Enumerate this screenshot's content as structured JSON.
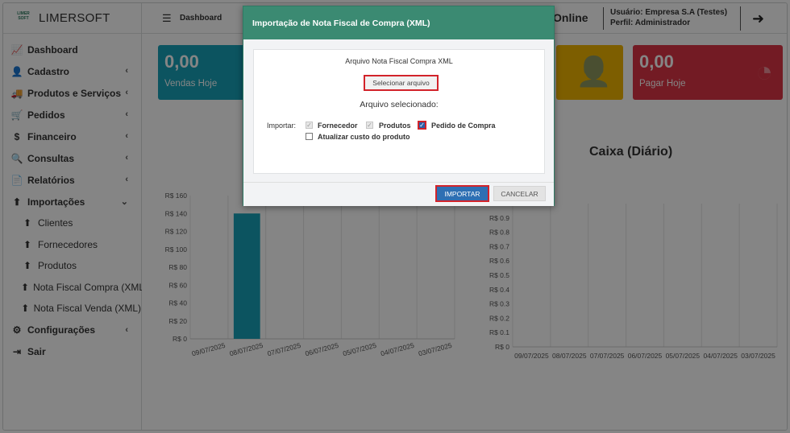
{
  "brand": {
    "logo_text": "LIMER SOFT",
    "name": "LIMERSOFT"
  },
  "menu": [
    {
      "label": "Dashboard",
      "icon": "chart-line-icon",
      "glyph": "📈",
      "chevron": ""
    },
    {
      "label": "Cadastro",
      "icon": "user-icon",
      "glyph": "👤",
      "chevron": "‹"
    },
    {
      "label": "Produtos e Serviços",
      "icon": "truck-icon",
      "glyph": "🚚",
      "chevron": "‹"
    },
    {
      "label": "Pedidos",
      "icon": "cart-icon",
      "glyph": "🛒",
      "chevron": "‹"
    },
    {
      "label": "Financeiro",
      "icon": "dollar-icon",
      "glyph": "$",
      "chevron": "‹"
    },
    {
      "label": "Consultas",
      "icon": "search-icon",
      "glyph": "🔍",
      "chevron": "‹"
    },
    {
      "label": "Relatórios",
      "icon": "file-icon",
      "glyph": "📄",
      "chevron": "‹"
    },
    {
      "label": "Importações",
      "icon": "upload-icon",
      "glyph": "⬆",
      "chevron": "⌄"
    }
  ],
  "submenu": [
    {
      "label": "Clientes"
    },
    {
      "label": "Fornecedores"
    },
    {
      "label": "Produtos"
    },
    {
      "label": "Nota Fiscal Compra (XML)"
    },
    {
      "label": "Nota Fiscal Venda (XML)"
    }
  ],
  "menu_bottom": [
    {
      "label": "Configurações",
      "icon": "gear-icon",
      "glyph": "⚙",
      "chevron": "‹"
    },
    {
      "label": "Sair",
      "icon": "sign-out-icon",
      "glyph": "⇥",
      "chevron": ""
    }
  ],
  "topbar": {
    "breadcrumb": "Dashboard",
    "status": "Online",
    "user_line": "Usuário: Empresa S.A (Testes)",
    "profile_line": "Perfil: Administrador"
  },
  "cards": [
    {
      "value": "0,00",
      "label": "Vendas Hoje",
      "color": "#17a2b8"
    },
    {
      "value": "",
      "label": "",
      "color": "#f0b400"
    },
    {
      "value": "0,00",
      "label": "Pagar Hoje",
      "color": "#dc3545"
    }
  ],
  "charts": {
    "right_title": "Caixa (Diário)"
  },
  "chart_data": [
    {
      "type": "bar",
      "title": "",
      "categories": [
        "09/07/2025",
        "08/07/2025",
        "07/07/2025",
        "06/07/2025",
        "05/07/2025",
        "04/07/2025",
        "03/07/2025"
      ],
      "values": [
        0,
        140,
        0,
        0,
        0,
        0,
        0
      ],
      "ylim": [
        0,
        160
      ],
      "yticks": [
        "R$ 0",
        "R$ 20",
        "R$ 40",
        "R$ 60",
        "R$ 80",
        "R$ 100",
        "R$ 120",
        "R$ 140",
        "R$ 160"
      ],
      "color": "#17a2b8"
    },
    {
      "type": "bar",
      "title": "Caixa (Diário)",
      "categories": [
        "09/07/2025",
        "08/07/2025",
        "07/07/2025",
        "06/07/2025",
        "05/07/2025",
        "04/07/2025",
        "03/07/2025"
      ],
      "values": [
        0,
        0,
        0,
        0,
        0,
        0,
        0
      ],
      "ylim": [
        0,
        1
      ],
      "yticks": [
        "R$ 0",
        "R$ 0.1",
        "R$ 0.2",
        "R$ 0.3",
        "R$ 0.4",
        "R$ 0.5",
        "R$ 0.6",
        "R$ 0.7",
        "R$ 0.8",
        "R$ 0.9"
      ]
    }
  ],
  "modal": {
    "title": "Importação de Nota Fiscal de Compra (XML)",
    "file_label": "Arquivo Nota Fiscal Compra XML",
    "select_button": "Selecionar arquivo",
    "selected_label": "Arquivo selecionado:",
    "import_label": "Importar:",
    "options": [
      {
        "label": "Fornecedor",
        "checked": true,
        "disabled": true
      },
      {
        "label": "Produtos",
        "checked": true,
        "disabled": true
      },
      {
        "label": "Pedido de Compra",
        "checked": true,
        "disabled": false
      },
      {
        "label": "Atualizar custo do produto",
        "checked": false,
        "disabled": false
      }
    ],
    "import_button": "IMPORTAR",
    "cancel_button": "CANCELAR"
  }
}
